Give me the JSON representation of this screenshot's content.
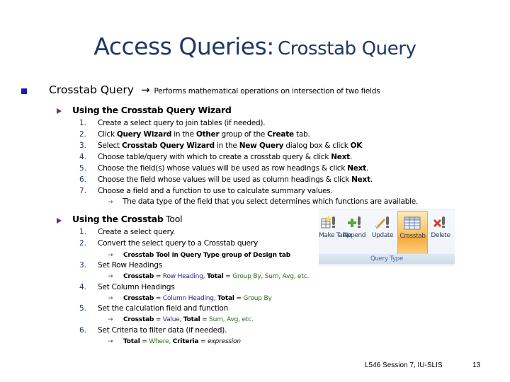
{
  "title": {
    "main": "Access Queries:",
    "sub": "Crosstab Query"
  },
  "bullet": {
    "term": "Crosstab Query",
    "arrow": "→",
    "description": "Performs mathematical operations on intersection of two fields"
  },
  "section1": {
    "heading": "Using the Crosstab Query Wizard",
    "steps": [
      {
        "num": "1.",
        "parts": [
          {
            "t": "Create a select query to join tables (if needed)."
          }
        ]
      },
      {
        "num": "2.",
        "parts": [
          {
            "t": "Click "
          },
          {
            "t": "Query Wizard",
            "b": true
          },
          {
            "t": " in the "
          },
          {
            "t": "Other",
            "b": true
          },
          {
            "t": " group of the "
          },
          {
            "t": "Create",
            "b": true
          },
          {
            "t": " tab."
          }
        ]
      },
      {
        "num": "3.",
        "parts": [
          {
            "t": "Select "
          },
          {
            "t": "Crosstab Query Wizard",
            "b": true
          },
          {
            "t": " in the "
          },
          {
            "t": "New Query",
            "b": true
          },
          {
            "t": " dialog box & click "
          },
          {
            "t": "OK",
            "b": true
          }
        ]
      },
      {
        "num": "4.",
        "parts": [
          {
            "t": "Choose table/query with which to create a crosstab query & click "
          },
          {
            "t": "Next",
            "b": true
          },
          {
            "t": "."
          }
        ]
      },
      {
        "num": "5.",
        "parts": [
          {
            "t": "Choose the field(s) whose values will be used as row headings & click "
          },
          {
            "t": "Next",
            "b": true
          },
          {
            "t": "."
          }
        ]
      },
      {
        "num": "6.",
        "parts": [
          {
            "t": "Choose the field whose values will be used as column headings & click "
          },
          {
            "t": "Next",
            "b": true
          },
          {
            "t": "."
          }
        ]
      },
      {
        "num": "7.",
        "parts": [
          {
            "t": "Choose a field and a function to use to calculate summary values."
          }
        ]
      }
    ],
    "note": "The data type of the field that you select determines which functions are available."
  },
  "section2": {
    "heading_bold": "Using the Crosstab",
    "heading_normal": " Tool",
    "steps": [
      {
        "num": "1.",
        "text": "Create a select query."
      },
      {
        "num": "2.",
        "text": "Convert the select query to a Crosstab query",
        "sub": [
          {
            "t": "Crosstab Tool in Query Type group of Design tab",
            "b": true
          }
        ]
      },
      {
        "num": "3.",
        "text": "Set Row Headings",
        "sub": [
          {
            "t": "Crosstab",
            "b": true
          },
          {
            "t": " = "
          },
          {
            "t": "Row Heading,",
            "c": "blue"
          },
          {
            "t": "   "
          },
          {
            "t": "Total",
            "b": true
          },
          {
            "t": " = "
          },
          {
            "t": "Group By, Sum, Avg, etc.",
            "c": "green"
          }
        ]
      },
      {
        "num": "4.",
        "text": "Set Column Headings",
        "sub": [
          {
            "t": "Crosstab",
            "b": true
          },
          {
            "t": " = "
          },
          {
            "t": "Column Heading,",
            "c": "blue"
          },
          {
            "t": "   "
          },
          {
            "t": "Total",
            "b": true
          },
          {
            "t": " = "
          },
          {
            "t": "Group By",
            "c": "green"
          }
        ]
      },
      {
        "num": "5.",
        "text": "Set the calculation field and function",
        "sub": [
          {
            "t": "Crosstab",
            "b": true
          },
          {
            "t": " = "
          },
          {
            "t": "Value,",
            "c": "blue"
          },
          {
            "t": "   "
          },
          {
            "t": "Total",
            "b": true
          },
          {
            "t": " = "
          },
          {
            "t": "Sum, Avg, etc.",
            "c": "green"
          }
        ]
      },
      {
        "num": "6.",
        "text": "Set Criteria to filter data (if needed).",
        "sub": [
          {
            "t": "Total",
            "b": true
          },
          {
            "t": " = "
          },
          {
            "t": "Where,",
            "c": "green"
          },
          {
            "t": " "
          },
          {
            "t": "Criteria",
            "b": true
          },
          {
            "t": " = "
          },
          {
            "t": "expression",
            "i": true
          }
        ]
      }
    ]
  },
  "sub_arrow": "→",
  "ribbon": {
    "buttons": [
      {
        "label": "Make Table",
        "icon": "make-table-icon"
      },
      {
        "label": "Append",
        "icon": "append-icon"
      },
      {
        "label": "Update",
        "icon": "update-icon"
      },
      {
        "label": "Crosstab",
        "icon": "crosstab-icon",
        "active": true
      },
      {
        "label": "Delete",
        "icon": "delete-icon"
      }
    ],
    "group_label": "Query Type",
    "colors": {
      "active_top": "#fde9b8",
      "active_mid": "#f9a93a",
      "group_bar": "#cfdcec"
    }
  },
  "footer": {
    "text": "L546 Session 7, IU-SLIS",
    "page": "13"
  },
  "colors": {
    "title": "#1f3864",
    "bullet_square": "#1a1ab8",
    "bullet_triangle": "#6b2a8a",
    "blue_value": "#1e1e8c",
    "green_value": "#2a6b1a"
  }
}
